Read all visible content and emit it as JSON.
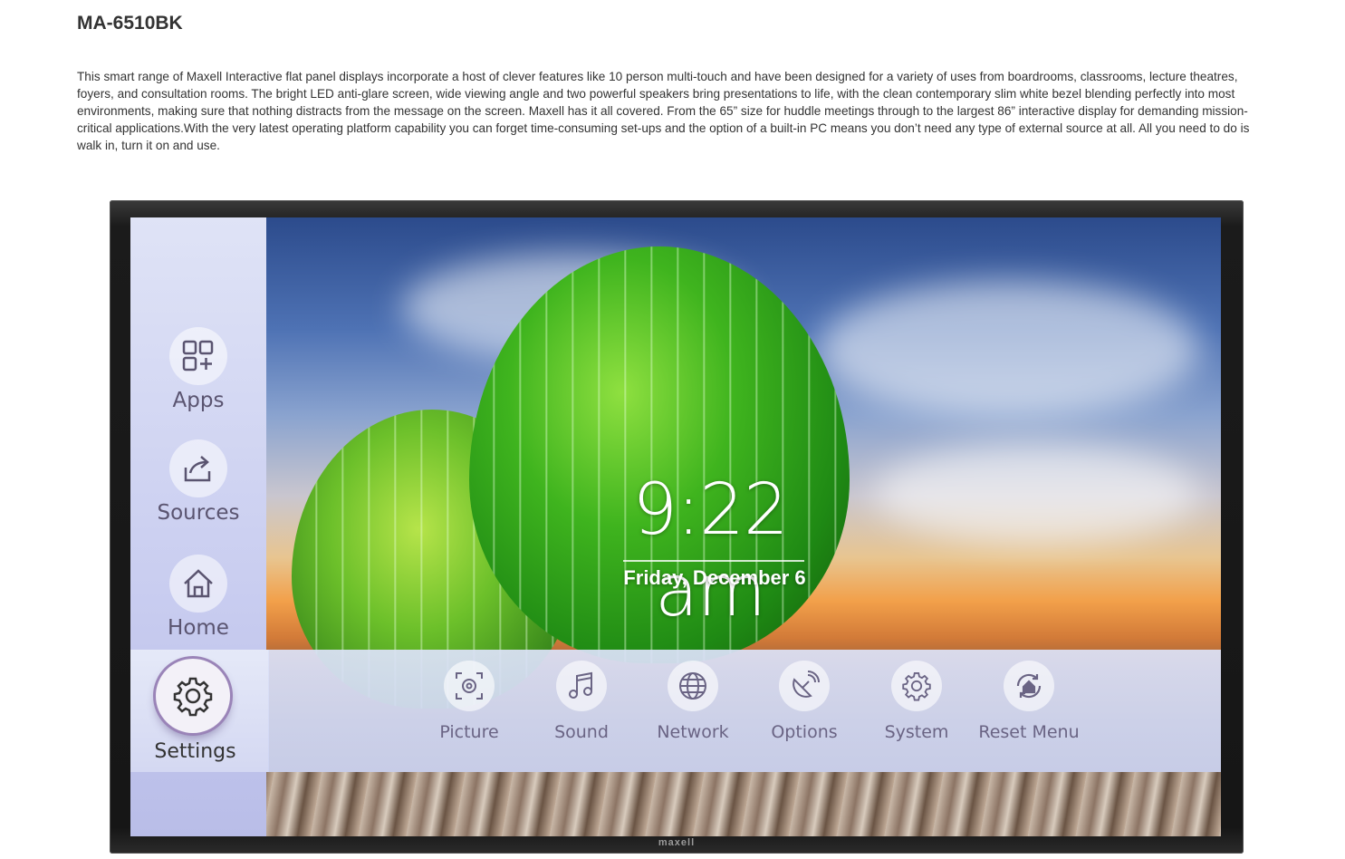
{
  "product": {
    "title": "MA-6510BK",
    "description": "This smart range of Maxell Interactive flat panel displays incorporate a host of clever features like 10 person multi-touch and have been designed for a variety of uses from boardrooms, classrooms, lecture theatres, foyers, and consultation rooms. The bright LED anti-glare screen, wide viewing angle and two powerful speakers bring presentations to life, with the clean contemporary slim white bezel blending perfectly into most environments, making sure that nothing distracts from the message on the screen. Maxell has it all covered. From the 65” size for huddle meetings through to the largest 86” interactive display for demanding mission-critical applications.With the very latest operating platform capability you can forget time-consuming set-ups and the option of a built-in PC means you don’t need any type of external source at all. All you need to do is walk in, turn it on and use."
  },
  "display": {
    "brand": "maxell",
    "time": "9:22 am",
    "date": "Friday, December 6",
    "sidebar": [
      {
        "label": "Apps",
        "icon": "apps-icon"
      },
      {
        "label": "Sources",
        "icon": "sources-icon"
      },
      {
        "label": "Home",
        "icon": "home-icon"
      },
      {
        "label": "Settings",
        "icon": "gear-icon",
        "selected": true
      }
    ],
    "settings_menu": [
      {
        "label": "Picture",
        "icon": "picture-icon"
      },
      {
        "label": "Sound",
        "icon": "music-note-icon"
      },
      {
        "label": "Network",
        "icon": "globe-icon"
      },
      {
        "label": "Options",
        "icon": "satellite-icon"
      },
      {
        "label": "System",
        "icon": "gear-icon"
      },
      {
        "label": "Reset Menu",
        "icon": "reset-home-icon"
      }
    ],
    "colors": {
      "icon": "#5a5470",
      "accent": "#9a84b8"
    }
  }
}
